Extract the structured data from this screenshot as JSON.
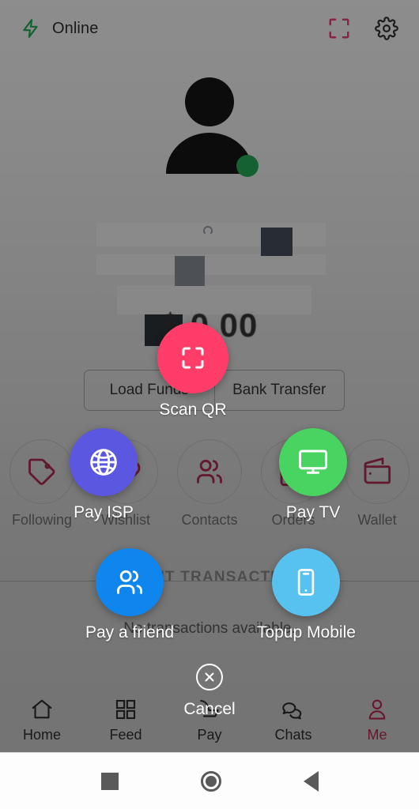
{
  "statusbar": {
    "connection_label": "Online",
    "bolt_icon": "lightning-bolt-icon",
    "scan_icon": "scan-frame-icon",
    "settings_icon": "gear-icon",
    "accent_pink": "#FF3D68",
    "online_green": "#17A24A"
  },
  "profile": {
    "avatar_icon": "person-avatar-icon",
    "presence": "online",
    "balance_text": "$ 0.00"
  },
  "actions": {
    "load_funds_label": "Load Funds",
    "bank_transfer_label": "Bank Transfer"
  },
  "quick_actions": [
    {
      "label": "Following",
      "icon": "tag-icon"
    },
    {
      "label": "Wishlist",
      "icon": "heart-icon"
    },
    {
      "label": "Contacts",
      "icon": "contacts-icon"
    },
    {
      "label": "Orders",
      "icon": "orders-icon"
    },
    {
      "label": "Wallet",
      "icon": "wallet-icon"
    }
  ],
  "recent": {
    "title": "RECENT TRANSACTIONS",
    "empty_text": "No transactions available."
  },
  "tabbar": [
    {
      "label": "Home",
      "icon": "home-icon",
      "active": false
    },
    {
      "label": "Feed",
      "icon": "grid-icon",
      "active": false
    },
    {
      "label": "Pay",
      "icon": "pay-icon",
      "active": false
    },
    {
      "label": "Chats",
      "icon": "chat-bubbles-icon",
      "active": false
    },
    {
      "label": "Me",
      "icon": "person-icon",
      "active": true
    }
  ],
  "speed_dial": {
    "open": true,
    "items": [
      {
        "label": "Scan QR",
        "icon": "scan-frame-icon",
        "color": "#FF3D68"
      },
      {
        "label": "Pay ISP",
        "icon": "globe-icon",
        "color": "#5B57E0"
      },
      {
        "label": "Pay TV",
        "icon": "monitor-icon",
        "color": "#49D462"
      },
      {
        "label": "Pay a friend",
        "icon": "contacts-icon",
        "color": "#0F86EE"
      },
      {
        "label": "Topup Mobile",
        "icon": "smartphone-icon",
        "color": "#57C1EF"
      }
    ],
    "cancel_label": "Cancel",
    "cancel_icon": "close-circle-icon"
  },
  "system_nav": {
    "recents_icon": "square-recents-icon",
    "home_icon": "circle-home-icon",
    "back_icon": "triangle-back-icon"
  }
}
